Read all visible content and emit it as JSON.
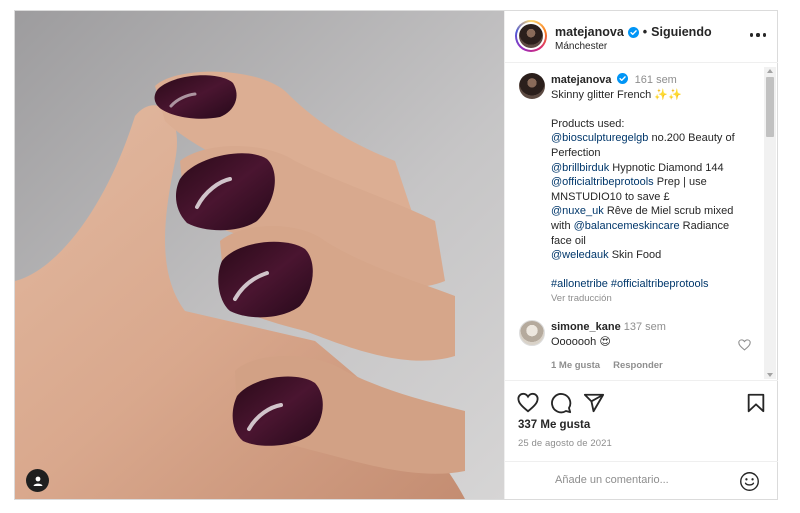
{
  "header": {
    "username": "matejanova",
    "separator": "•",
    "follow_label": "Siguiendo",
    "location": "Mánchester"
  },
  "caption": {
    "username": "matejanova",
    "age": "161 sem",
    "lines": [
      "Skinny glitter French ✨✨",
      "",
      "Products used:"
    ],
    "products": [
      {
        "mention": "@biosculpturegelgb",
        "text": " no.200 Beauty of"
      },
      {
        "mention": "",
        "text": "Perfection"
      },
      {
        "mention": "@brillbirduk",
        "text": " Hypnotic Diamond 144"
      },
      {
        "mention": "@officialtribeprotools",
        "text": " Prep | use"
      },
      {
        "mention": "",
        "text": "MNSTUDIO10 to save £"
      },
      {
        "mention": "@nuxe_uk",
        "text": " Rêve de Miel scrub mixed"
      },
      {
        "mention": "with ",
        "text": ""
      },
      {
        "mention": "",
        "text": "face oil"
      },
      {
        "mention": "@weledauk",
        "text": " Skin Food"
      }
    ],
    "balance_prefix": "with ",
    "balance_mention": "@balancemeskincare",
    "balance_suffix": " Radiance",
    "hashtags": "#allonetribe #officialtribeprotools",
    "see_translation": "Ver traducción"
  },
  "comment": {
    "username": "simone_kane",
    "age": "137 sem",
    "text": "Ooooooh 😍",
    "likes": "1 Me gusta",
    "reply": "Responder"
  },
  "actions": {
    "likes_count": "337 Me gusta",
    "date": "25 de agosto de 2021",
    "comment_placeholder": "Añade un comentario..."
  },
  "icons": [
    "verified-badge-icon",
    "more-options-icon",
    "heart-icon",
    "comment-icon",
    "share-icon",
    "bookmark-icon",
    "emoji-icon",
    "tagged-user-icon"
  ],
  "colors": {
    "link": "#00376b",
    "verified": "#0095f6",
    "secondary_text": "#8e8e8e",
    "nail_polish": "#3d0f24"
  }
}
